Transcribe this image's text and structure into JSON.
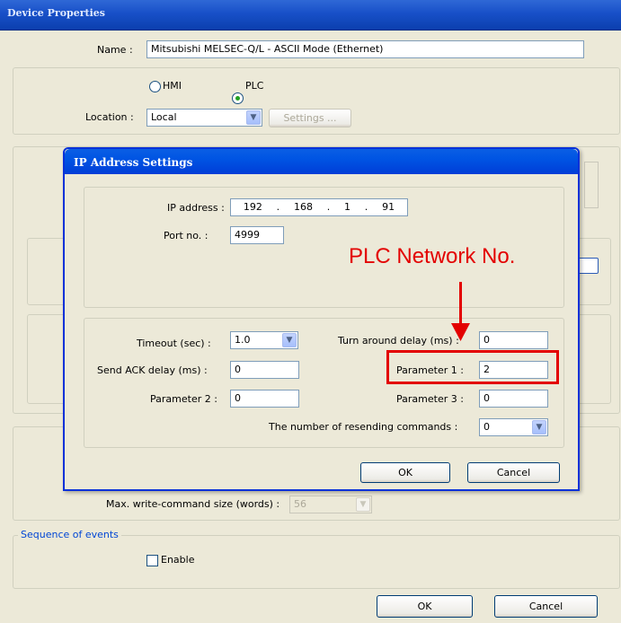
{
  "window": {
    "title": "Device Properties"
  },
  "device": {
    "name_label": "Name :",
    "name_value": "Mitsubishi MELSEC-Q/L - ASCII Mode (Ethernet)",
    "radio_hmi": "HMI",
    "radio_plc": "PLC",
    "selected_target": "PLC",
    "location_label": "Location :",
    "location_value": "Local",
    "settings_button": "Settings ..."
  },
  "lower": {
    "max_write_label": "Max. write-command size (words) :",
    "max_write_value": "56",
    "sequence_group": "Sequence of events",
    "enable_label": "Enable",
    "ok": "OK",
    "cancel": "Cancel"
  },
  "ip_dialog": {
    "title": "IP Address Settings",
    "ip_label": "IP address :",
    "ip_octets": [
      "192",
      "168",
      "1",
      "91"
    ],
    "port_label": "Port no. :",
    "port_value": "4999",
    "timeout_label": "Timeout (sec) :",
    "timeout_value": "1.0",
    "turn_around_label": "Turn around delay (ms) :",
    "turn_around_value": "0",
    "send_ack_label": "Send ACK delay (ms) :",
    "send_ack_value": "0",
    "param1_label": "Parameter 1 :",
    "param1_value": "2",
    "param2_label": "Parameter 2 :",
    "param2_value": "0",
    "param3_label": "Parameter 3 :",
    "param3_value": "0",
    "resend_label": "The number of resending commands :",
    "resend_value": "0",
    "ok": "OK",
    "cancel": "Cancel"
  },
  "annotation": {
    "text": "PLC Network No.",
    "color": "#e30000"
  }
}
